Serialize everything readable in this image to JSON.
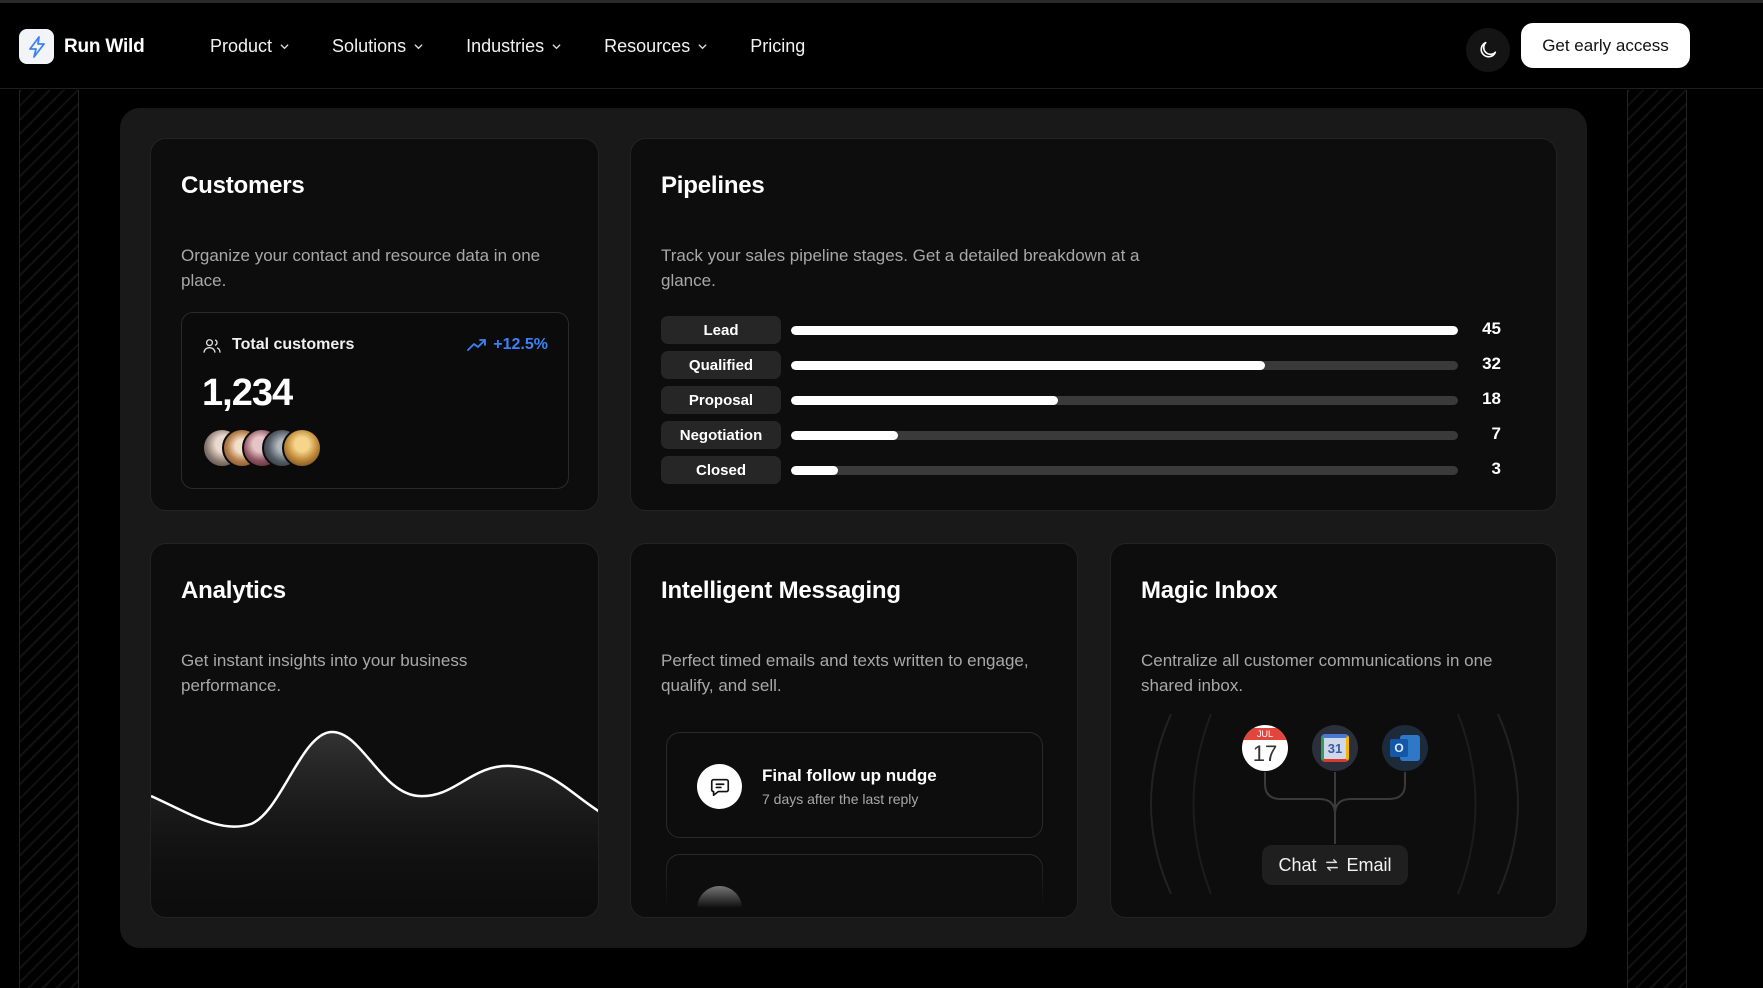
{
  "nav": {
    "brand": "Run Wild",
    "menu": [
      {
        "label": "Product",
        "has_dropdown": true
      },
      {
        "label": "Solutions",
        "has_dropdown": true
      },
      {
        "label": "Industries",
        "has_dropdown": true
      },
      {
        "label": "Resources",
        "has_dropdown": true
      },
      {
        "label": "Pricing",
        "has_dropdown": false
      }
    ],
    "theme_icon": "moon-icon",
    "cta_label": "Get early access"
  },
  "customers": {
    "title": "Customers",
    "description": "Organize your contact and resource data in one place.",
    "total_label": "Total customers",
    "growth": "+12.5%",
    "total_value": "1,234"
  },
  "pipelines": {
    "title": "Pipelines",
    "description": "Track your sales pipeline stages. Get a detailed breakdown at a glance.",
    "stages": [
      {
        "label": "Lead",
        "count": "45",
        "progress": 1.0
      },
      {
        "label": "Qualified",
        "count": "32",
        "progress": 0.711
      },
      {
        "label": "Proposal",
        "count": "18",
        "progress": 0.4
      },
      {
        "label": "Negotiation",
        "count": "7",
        "progress": 0.16
      },
      {
        "label": "Closed",
        "count": "3",
        "progress": 0.07
      }
    ]
  },
  "analytics": {
    "title": "Analytics",
    "description": "Get instant insights into your business performance."
  },
  "messaging": {
    "title": "Intelligent Messaging",
    "description": "Perfect timed emails and texts written to engage, qualify, and sell.",
    "items": [
      {
        "title": "Final follow up nudge",
        "subtitle": "7 days after the last reply"
      }
    ]
  },
  "inbox": {
    "title": "Magic Inbox",
    "description": "Centralize all customer communications in one shared inbox.",
    "calendar_month": "JUL",
    "calendar_day": "17",
    "google_calendar_day": "31",
    "outlook_letter": "O",
    "chip_left": "Chat",
    "chip_right": "Email"
  },
  "colors": {
    "accent_blue": "#3b82f6",
    "card_bg": "#0d0d0d",
    "panel_bg": "#191919"
  }
}
